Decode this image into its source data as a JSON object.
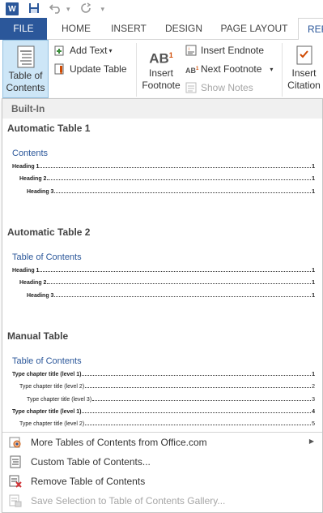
{
  "quick_access": {
    "word_logo": "W",
    "icons": [
      "word-logo-icon",
      "save-icon",
      "undo-icon",
      "redo-icon",
      "customize-icon"
    ]
  },
  "tabs": [
    {
      "label": "FILE",
      "active": false
    },
    {
      "label": "HOME",
      "active": false
    },
    {
      "label": "INSERT",
      "active": false
    },
    {
      "label": "DESIGN",
      "active": false
    },
    {
      "label": "PAGE LAYOUT",
      "active": false
    },
    {
      "label": "REF",
      "active": true
    }
  ],
  "ribbon": {
    "toc_button": {
      "line1": "Table of",
      "line2": "Contents"
    },
    "add_text": "Add Text",
    "update_table": "Update Table",
    "insert_footnote": {
      "line1": "Insert",
      "line2": "Footnote"
    },
    "insert_endnote": "Insert Endnote",
    "next_footnote": "Next Footnote",
    "show_notes": "Show Notes",
    "insert_citation": {
      "line1": "Insert",
      "line2": "Citation"
    }
  },
  "dropdown": {
    "header": "Built-In",
    "sections": [
      {
        "name": "Automatic Table 1",
        "toc_title": "Contents",
        "entries": [
          {
            "text": "Heading 1",
            "page": "1",
            "level": 1
          },
          {
            "text": "Heading 2",
            "page": "1",
            "level": 2
          },
          {
            "text": "Heading 3",
            "page": "1",
            "level": 3
          }
        ]
      },
      {
        "name": "Automatic Table 2",
        "toc_title": "Table of Contents",
        "entries": [
          {
            "text": "Heading 1",
            "page": "1",
            "level": 1
          },
          {
            "text": "Heading 2",
            "page": "1",
            "level": 2
          },
          {
            "text": "Heading 3",
            "page": "1",
            "level": 3
          }
        ]
      },
      {
        "name": "Manual Table",
        "toc_title": "Table of Contents",
        "entries": [
          {
            "text": "Type chapter title (level 1)",
            "page": "1",
            "level": 1
          },
          {
            "text": "Type chapter title (level 2)",
            "page": "2",
            "level": 2
          },
          {
            "text": "Type chapter title (level 3)",
            "page": "3",
            "level": 3
          },
          {
            "text": "Type chapter title (level 1)",
            "page": "4",
            "level": 1
          },
          {
            "text": "Type chapter title (level 2)",
            "page": "5",
            "level": 2
          }
        ]
      }
    ],
    "menu": [
      {
        "label": "More Tables of Contents from Office.com",
        "icon": "office-icon",
        "enabled": true,
        "submenu": true
      },
      {
        "label": "Custom Table of Contents...",
        "icon": "custom-toc-icon",
        "enabled": true,
        "submenu": false
      },
      {
        "label": "Remove Table of Contents",
        "icon": "remove-toc-icon",
        "enabled": true,
        "submenu": false
      },
      {
        "label": "Save Selection to Table of Contents Gallery...",
        "icon": "save-gallery-icon",
        "enabled": false,
        "submenu": false
      }
    ]
  },
  "colors": {
    "accent": "#2b579a",
    "toc_button_bg": "#cde6f7",
    "disabled_text": "#a6a6a6"
  }
}
